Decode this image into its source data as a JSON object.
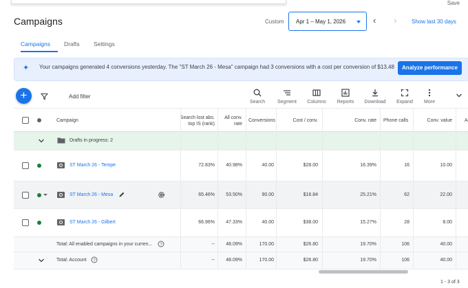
{
  "top": {
    "save_label": "Save"
  },
  "header": {
    "title": "Campaigns",
    "custom_label": "Custom",
    "date_range": "Apr 1 – May 1, 2026",
    "show_last": "Show last 30 days"
  },
  "tabs": [
    {
      "label": "Campaigns",
      "active": true
    },
    {
      "label": "Drafts",
      "active": false
    },
    {
      "label": "Settings",
      "active": false
    }
  ],
  "banner": {
    "text": "Your campaigns generated 4 conversions yesterday. The \"ST March 26 - Mesa\" campaign had 3 conversions with a cost per conversion of $13.48",
    "button": "Analyze performance"
  },
  "toolbar": {
    "add_filter": "Add filter",
    "tools": [
      "Search",
      "Segment",
      "Columns",
      "Reports",
      "Download",
      "Expand",
      "More"
    ]
  },
  "table": {
    "headers": {
      "campaign": "Campaign",
      "search_lost": "Search lost abs. top IS (rank)",
      "all_conv_rate": "All conv. rate",
      "conversions": "Conversions",
      "cost_conv": "Cost / conv.",
      "conv_rate": "Conv. rate",
      "phone_calls": "Phone calls",
      "conv_value": "Conv. value"
    },
    "drafts_label": "Drafts in progress: 2",
    "rows": [
      {
        "name": "ST March 26 - Tempe",
        "search_lost": "72.83%",
        "all_conv_rate": "40.98%",
        "conversions": "40.00",
        "cost_conv": "$28.00",
        "conv_rate": "16.39%",
        "phone_calls": "16",
        "conv_value": "10.00"
      },
      {
        "name": "ST March 26 - Mesa",
        "search_lost": "65.46%",
        "all_conv_rate": "53.50%",
        "conversions": "90.00",
        "cost_conv": "$16.84",
        "conv_rate": "25.21%",
        "phone_calls": "62",
        "conv_value": "22.00"
      },
      {
        "name": "ST March 26 - Gilbert",
        "search_lost": "66.96%",
        "all_conv_rate": "47.33%",
        "conversions": "40.00",
        "cost_conv": "$38.00",
        "conv_rate": "15.27%",
        "phone_calls": "28",
        "conv_value": "8.00"
      }
    ],
    "totals": [
      {
        "label": "Total: All enabled campaigns in your curren...",
        "search_lost": "--",
        "all_conv_rate": "48.09%",
        "conversions": "170.00",
        "cost_conv": "$26.80",
        "conv_rate": "19.70%",
        "phone_calls": "106",
        "conv_value": "40.00"
      },
      {
        "label": "Total: Account",
        "search_lost": "--",
        "all_conv_rate": "48.09%",
        "conversions": "170.00",
        "cost_conv": "$26.80",
        "conv_rate": "19.70%",
        "phone_calls": "106",
        "conv_value": "40.00"
      }
    ]
  },
  "pager": "1 - 3 of 3",
  "colors": {
    "accent": "#1a73e8",
    "enabled": "#188038",
    "drafts_bg": "#e6f4ea"
  }
}
